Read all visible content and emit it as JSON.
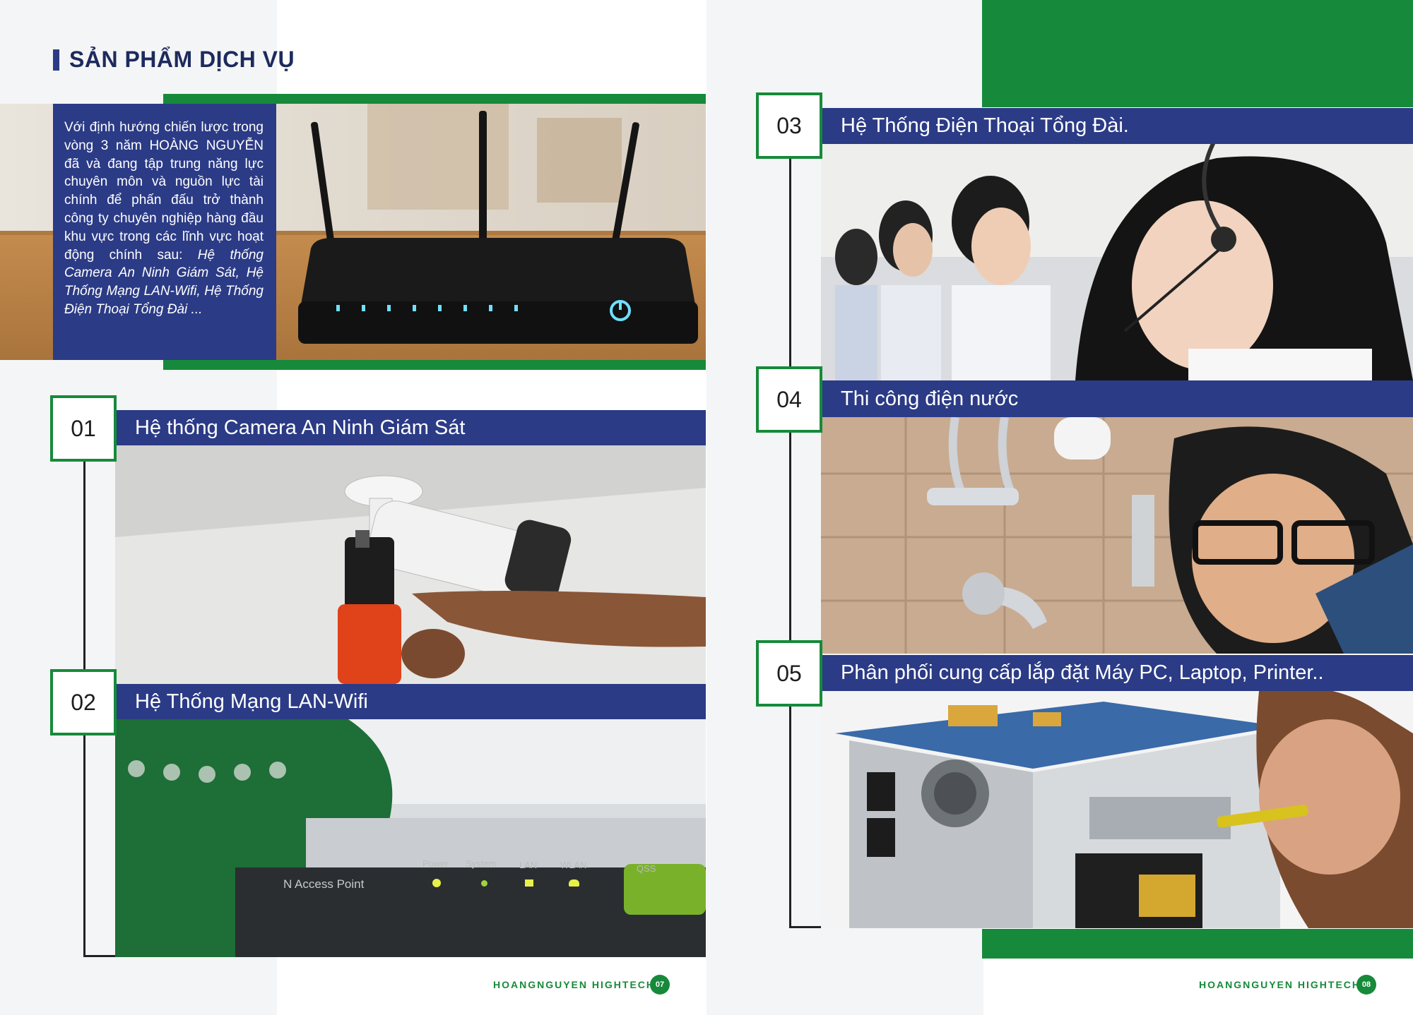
{
  "left_page": {
    "title": "SẢN PHẨM DỊCH VỤ",
    "intro_plain": "Với định hướng chiến lược trong vòng 3 năm HOÀNG NGUYỄN đã và đang tập trung năng lực chuyên môn và nguồn lực tài chính để phấn đấu trở thành công ty chuyên nghiệp hàng đầu khu vực trong các lĩnh vực hoạt động chính sau: ",
    "intro_italic": "Hệ thống Camera An Ninh Giám Sát, Hệ Thống Mạng LAN-Wifi, Hệ Thống Điện Thoại Tổng Đài ...",
    "footer_brand": "HOANGNGUYEN HIGHTECH",
    "page_number": "07"
  },
  "right_page": {
    "footer_brand": "HOANGNGUYEN HIGHTECH",
    "page_number": "08"
  },
  "services": [
    {
      "number": "01",
      "label": "Hệ thống Camera An Ninh Giám Sát"
    },
    {
      "number": "02",
      "label": "Hệ Thống Mạng LAN-Wifi"
    },
    {
      "number": "03",
      "label": "Hệ Thống Điện Thoại Tổng Đài."
    },
    {
      "number": "04",
      "label": "Thi công điện nước"
    },
    {
      "number": "05",
      "label": "Phân phối cung cấp lắp đặt Máy PC, Laptop, Printer.."
    }
  ],
  "router_led_labels": [
    "Power",
    "System",
    "LAN",
    "WLAN",
    "QSS"
  ],
  "router_brand_text": "N Access Point",
  "colors": {
    "green": "#168a3a",
    "navy": "#2b3b86"
  }
}
